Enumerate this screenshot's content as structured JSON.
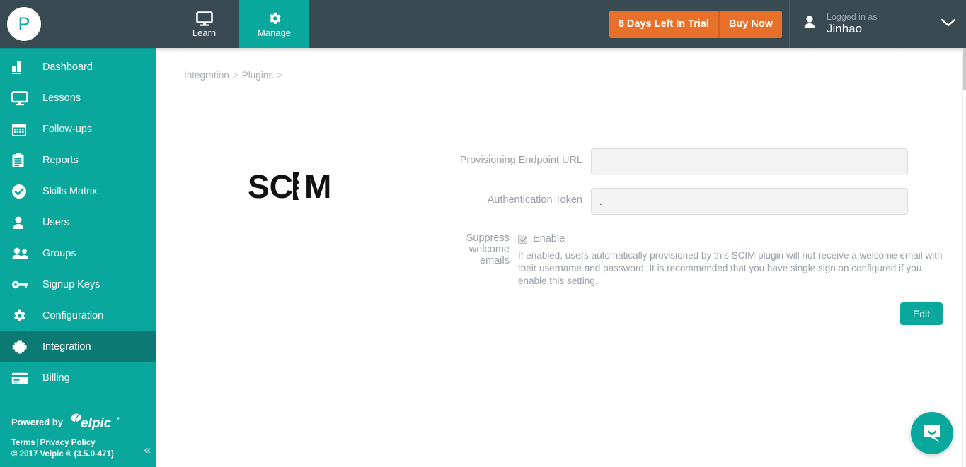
{
  "header": {
    "avatar_letter": "P",
    "nav": [
      {
        "label": "Learn",
        "icon": "monitor-icon",
        "active": false
      },
      {
        "label": "Manage",
        "icon": "gear-icon",
        "active": true
      }
    ],
    "trial": {
      "days_label": "8 Days Left In Trial",
      "buy_label": "Buy Now"
    },
    "user": {
      "logged_in_label": "Logged in as",
      "name": "Jinhao",
      "icon": "person-icon",
      "caret": "chevron-down-icon"
    }
  },
  "sidebar": {
    "items": [
      {
        "label": "Dashboard",
        "icon": "bar-chart-icon",
        "active": false
      },
      {
        "label": "Lessons",
        "icon": "monitor-icon",
        "active": false
      },
      {
        "label": "Follow-ups",
        "icon": "calendar-icon",
        "active": false
      },
      {
        "label": "Reports",
        "icon": "clipboard-icon",
        "active": false
      },
      {
        "label": "Skills Matrix",
        "icon": "check-circle-icon",
        "active": false
      },
      {
        "label": "Users",
        "icon": "person-icon",
        "active": false
      },
      {
        "label": "Groups",
        "icon": "people-icon",
        "active": false
      },
      {
        "label": "Signup Keys",
        "icon": "key-icon",
        "active": false
      },
      {
        "label": "Configuration",
        "icon": "gear-icon",
        "active": false
      },
      {
        "label": "Integration",
        "icon": "puzzle-icon",
        "active": true
      },
      {
        "label": "Billing",
        "icon": "credit-card-icon",
        "active": false
      }
    ],
    "footer": {
      "powered_by": "Powered by",
      "brand": "velpic",
      "terms": "Terms",
      "separator": "|",
      "privacy": "Privacy Policy",
      "copyright": "© 2017 Velpic ® (3.5.0-471)",
      "collapse_icon": "«"
    }
  },
  "main": {
    "breadcrumb": {
      "items": [
        "Integration",
        "Plugins"
      ],
      "separator": ">",
      "trailing_separator": ">"
    },
    "plugin_logo_text": "SCIM",
    "form": {
      "endpoint": {
        "label": "Provisioning Endpoint URL",
        "value": "",
        "placeholder": ""
      },
      "token": {
        "label": "Authentication Token",
        "value": ".",
        "placeholder": ""
      },
      "suppress": {
        "label": "Suppress welcome emails",
        "checkbox_label": "Enable",
        "checked": true,
        "help": "If enabled, users automatically provisioned by this SCIM plugin will not receive a welcome email with their username and password. It is recommended that you have single sign on configured if you enable this setting."
      },
      "edit_button": "Edit"
    },
    "chat_icon": "chat-bubble-icon"
  },
  "colors": {
    "header_bg": "#3a4a52",
    "sidebar_teal": "#0aa79c",
    "sidebar_active": "#0a7a72",
    "accent_orange": "#e8702a",
    "label_grey": "#9aa0a8",
    "input_bg": "#f3f3f3"
  }
}
